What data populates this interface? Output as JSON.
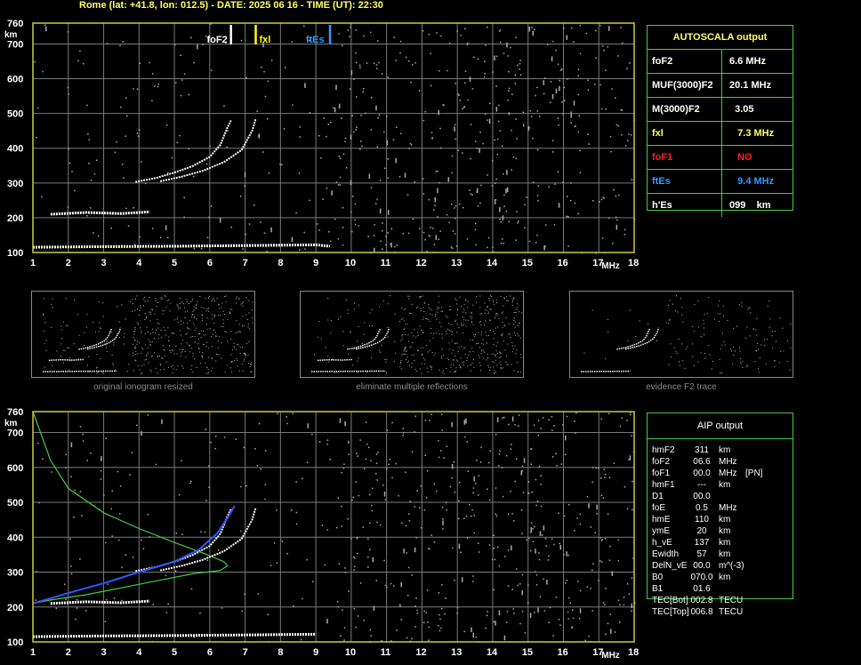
{
  "header": "Rome (lat: +41.8, lon: 012.5) - DATE: 2025 06 16 - TIME (UT): 22:30",
  "colors": {
    "grid": "#7a7a7a",
    "frame": "#cccc33",
    "yellow": "#ffff66",
    "red": "#ff2020",
    "blue": "#3399ff",
    "green": "#44cc44",
    "trace": "#ffffff"
  },
  "chart_data": [
    {
      "type": "scatter",
      "panel": "top",
      "xlabel": "MHz",
      "ylabel": "km",
      "xlim": [
        1,
        18
      ],
      "ylim": [
        100,
        760
      ],
      "x_ticks": [
        "1",
        "2",
        "3",
        "4",
        "5",
        "6",
        "7",
        "8",
        "9",
        "10",
        "11",
        "12",
        "13",
        "14",
        "15",
        "16",
        "17",
        "18"
      ],
      "y_ticks": [
        "100",
        "200",
        "300",
        "400",
        "500",
        "600",
        "700",
        "760"
      ],
      "markers": [
        {
          "label": "foF2",
          "freq": 6.6,
          "color": "#ffffff"
        },
        {
          "label": "fxl",
          "freq": 7.3,
          "color": "#ffff00"
        },
        {
          "label": "ftEs",
          "freq": 9.4,
          "color": "#3399ff"
        }
      ],
      "traces": {
        "o_mode": [
          [
            3.9,
            303
          ],
          [
            4.5,
            315
          ],
          [
            5.0,
            330
          ],
          [
            5.5,
            348
          ],
          [
            6.0,
            375
          ],
          [
            6.3,
            410
          ],
          [
            6.5,
            460
          ],
          [
            6.6,
            480
          ]
        ],
        "x_mode": [
          [
            4.6,
            305
          ],
          [
            5.2,
            318
          ],
          [
            5.8,
            335
          ],
          [
            6.4,
            360
          ],
          [
            6.9,
            395
          ],
          [
            7.2,
            450
          ],
          [
            7.3,
            485
          ]
        ],
        "es_layer": [
          [
            1.0,
            115
          ],
          [
            3.0,
            117
          ],
          [
            5.0,
            118
          ],
          [
            7.0,
            120
          ],
          [
            9.0,
            122
          ],
          [
            9.4,
            118
          ]
        ],
        "second_hop": [
          [
            1.5,
            210
          ],
          [
            2.5,
            215
          ],
          [
            3.5,
            212
          ],
          [
            4.3,
            217
          ]
        ]
      }
    },
    {
      "type": "line",
      "panel": "bottom",
      "xlabel": "MHz",
      "ylabel": "km",
      "xlim": [
        1,
        18
      ],
      "ylim": [
        100,
        760
      ],
      "x_ticks": [
        "1",
        "2",
        "3",
        "4",
        "5",
        "6",
        "7",
        "8",
        "9",
        "10",
        "11",
        "12",
        "13",
        "14",
        "15",
        "16",
        "17",
        "18"
      ],
      "y_ticks": [
        "100",
        "200",
        "300",
        "400",
        "500",
        "600",
        "700",
        "760"
      ],
      "series": [
        {
          "color": "#44cc44",
          "points": [
            [
              1.0,
              760
            ],
            [
              1.5,
              620
            ],
            [
              2.0,
              540
            ],
            [
              3.0,
              470
            ],
            [
              4.0,
              425
            ],
            [
              5.0,
              385
            ],
            [
              5.8,
              355
            ],
            [
              6.4,
              330
            ],
            [
              6.5,
              318
            ],
            [
              6.3,
              305
            ],
            [
              5.5,
              295
            ],
            [
              4.5,
              275
            ],
            [
              3.5,
              255
            ],
            [
              2.5,
              235
            ],
            [
              1.5,
              220
            ],
            [
              1.0,
              210
            ]
          ]
        },
        {
          "color": "#3355ff",
          "points": [
            [
              1.0,
              210
            ],
            [
              2.0,
              240
            ],
            [
              3.0,
              268
            ],
            [
              4.0,
              300
            ],
            [
              5.0,
              330
            ],
            [
              5.7,
              365
            ],
            [
              6.2,
              410
            ],
            [
              6.5,
              455
            ],
            [
              6.7,
              490
            ]
          ]
        }
      ],
      "traces": {
        "o_mode": [
          [
            3.9,
            303
          ],
          [
            4.5,
            315
          ],
          [
            5.0,
            330
          ],
          [
            5.5,
            348
          ],
          [
            6.0,
            375
          ],
          [
            6.3,
            410
          ],
          [
            6.5,
            460
          ],
          [
            6.6,
            480
          ]
        ],
        "x_mode": [
          [
            4.6,
            305
          ],
          [
            5.2,
            318
          ],
          [
            5.8,
            335
          ],
          [
            6.4,
            360
          ],
          [
            6.9,
            395
          ],
          [
            7.2,
            450
          ],
          [
            7.3,
            485
          ]
        ],
        "es_layer": [
          [
            1.0,
            115
          ],
          [
            3.0,
            117
          ],
          [
            5.0,
            118
          ],
          [
            7.0,
            120
          ],
          [
            9.0,
            122
          ]
        ],
        "second_hop": [
          [
            1.5,
            210
          ],
          [
            2.5,
            215
          ],
          [
            3.5,
            212
          ],
          [
            4.3,
            217
          ]
        ]
      }
    }
  ],
  "thumbnails": [
    {
      "caption": "original ionogram resized"
    },
    {
      "caption": "eliminate multiple reflections"
    },
    {
      "caption": "evidence F2 trace"
    }
  ],
  "autoscala": {
    "title": "AUTOSCALA output",
    "rows": [
      {
        "k": "foF2",
        "v": "6.6 MHz",
        "color": "#ffffff"
      },
      {
        "k": "MUF(3000)F2",
        "v": "20.1 MHz",
        "color": "#ffffff"
      },
      {
        "k": "M(3000)F2",
        "v": "  3.05",
        "color": "#ffffff"
      },
      {
        "k": "fxl",
        "v": "   7.3 MHz",
        "color": "#ffff66"
      },
      {
        "k": "foF1",
        "v": "   NO",
        "color": "#ff2020"
      },
      {
        "k": "ftEs",
        "v": "   9.4 MHz",
        "color": "#3399ff"
      },
      {
        "k": "h'Es",
        "v": "099    km",
        "color": "#ffffff"
      }
    ]
  },
  "aip": {
    "title": "AIP output",
    "rows": [
      [
        "hmF2",
        "311",
        "km",
        ""
      ],
      [
        "foF2",
        "06.6",
        "MHz",
        ""
      ],
      [
        "foF1",
        "00.0",
        "MHz",
        "[PN]"
      ],
      [
        "hmF1",
        "---",
        "km",
        ""
      ],
      [
        "D1",
        "00.0",
        "",
        ""
      ],
      [
        "foE",
        "0.5",
        "MHz",
        ""
      ],
      [
        "hmE",
        "110",
        "km",
        ""
      ],
      [
        "ymE",
        "20",
        "km",
        ""
      ],
      [
        "h_vE",
        "137",
        "km",
        ""
      ],
      [
        "Ewidth",
        "57",
        "km",
        ""
      ],
      [
        "DelN_vE",
        "00.0",
        "m^(-3)",
        ""
      ],
      [
        "B0",
        "070.0",
        "km",
        ""
      ],
      [
        "B1",
        "01.6",
        "",
        ""
      ],
      [
        "TEC[Bot]",
        "002.8",
        "TECU",
        ""
      ],
      [
        "TEC[Top]",
        "006.8",
        "TECU",
        ""
      ]
    ]
  }
}
